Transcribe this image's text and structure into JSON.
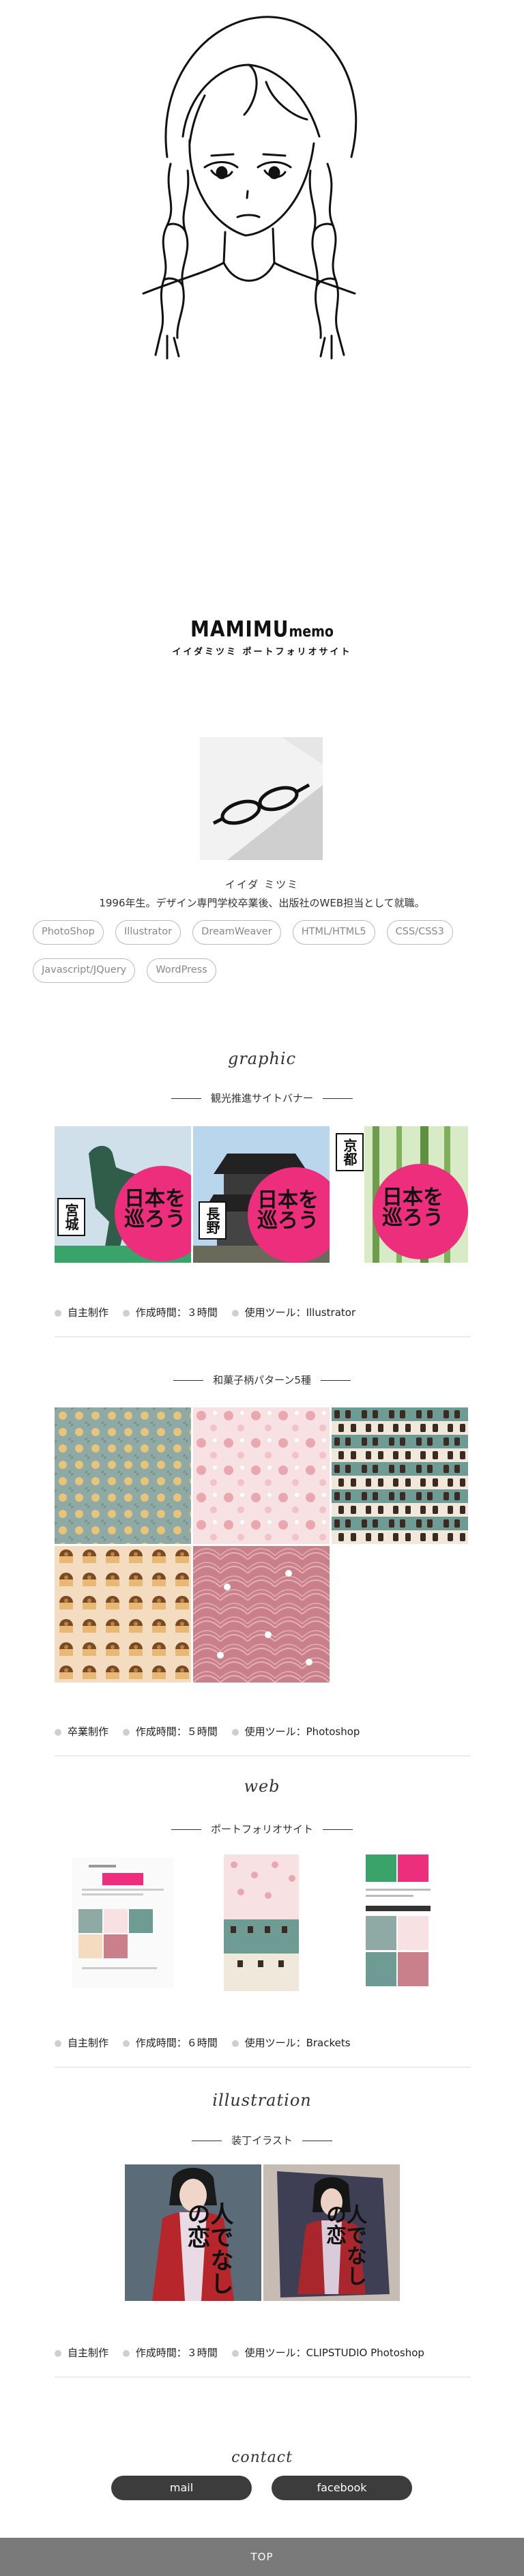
{
  "logo": {
    "main": "MAMIMU",
    "small": "memo",
    "sub": "イイダミツミ ポートフォリオサイト"
  },
  "profile": {
    "name": "イイダ ミツミ",
    "bio": "1996年生。デザイン専門学校卒業後、出版社のWEB担当として就職。",
    "skills": [
      "PhotoShop",
      "Illustrator",
      "DreamWeaver",
      "HTML/HTML5",
      "CSS/CSS3",
      "Javascript/JQuery",
      "WordPress"
    ]
  },
  "sections": {
    "graphic": "graphic",
    "web": "web",
    "illustration": "illustration",
    "contact": "contact"
  },
  "works": {
    "banner": {
      "title": "観光推進サイトバナー",
      "places": [
        "宮城",
        "長野",
        "京都"
      ],
      "banner_text": "日本を巡ろう",
      "meta": [
        "自主制作",
        "作成時間：３時間",
        "使用ツール：Illustrator"
      ]
    },
    "pattern": {
      "title": "和菓子柄パターン5種",
      "meta": [
        "卒業制作",
        "作成時間：５時間",
        "使用ツール：Photoshop"
      ]
    },
    "portfolio": {
      "title": "ポートフォリオサイト",
      "meta": [
        "自主制作",
        "作成時間：６時間",
        "使用ツール：Brackets"
      ]
    },
    "bookcover": {
      "title": "装丁イラスト",
      "cover_text": "人でなしの恋",
      "meta": [
        "自主制作",
        "作成時間：３時間",
        "使用ツール：CLIPSTUDIO Photoshop"
      ]
    }
  },
  "contact": {
    "mail": "mail",
    "facebook": "facebook"
  },
  "footer": {
    "top": "TOP"
  },
  "colors": {
    "accent_pink": "#ec2e7c",
    "button_dark": "#3c3c3c",
    "footer_gray": "#7a7a7a"
  }
}
